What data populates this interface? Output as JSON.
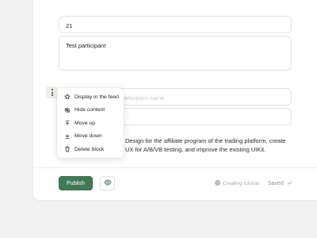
{
  "form": {
    "number_value": "21",
    "participant_value": "Test participant",
    "name_placeholder": "Participant name",
    "description": "Design for the affiliate program of the trading platform, create UX for A/B/VB testing, and improve the existing UIKit."
  },
  "block_menu": {
    "items": [
      {
        "label": "Display in the feed",
        "icon": "pin-icon"
      },
      {
        "label": "Hide content",
        "icon": "eye-off-icon"
      },
      {
        "label": "Move up",
        "icon": "move-up-icon"
      },
      {
        "label": "Move down",
        "icon": "move-down-icon"
      },
      {
        "label": "Delete block",
        "icon": "trash-icon"
      }
    ]
  },
  "footer": {
    "publish_label": "Publish",
    "tutorial_label": "Creating tutorial",
    "status_label": "Saved"
  },
  "colors": {
    "accent": "#3f7a55",
    "background": "#f1f2f1"
  }
}
